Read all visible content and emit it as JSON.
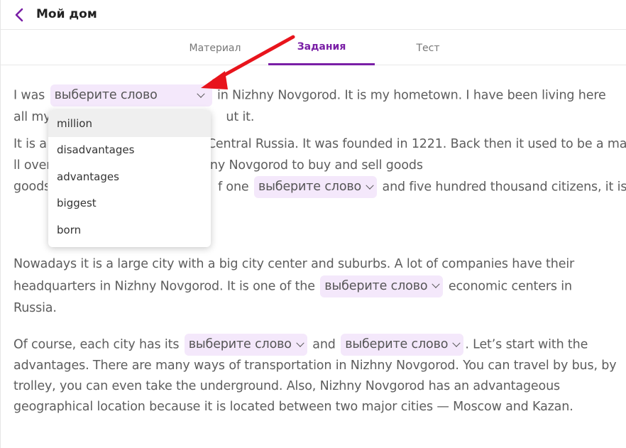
{
  "header": {
    "title": "Мой дом"
  },
  "tabs": [
    {
      "label": "Материал"
    },
    {
      "label": "Задания"
    },
    {
      "label": "Тест"
    }
  ],
  "select_placeholder": "выберите слово",
  "paragraphs": {
    "p1": {
      "t1": "I was",
      "t2": "in Nizhny Novgorod. It is my hometown. I have been living here all my life",
      "t3": "ut it."
    },
    "p2": {
      "t1": "It is a",
      "t2": "Central Russia. It was founded in 1221. Back then it used to be a major",
      "t3": "ll over the country came to Nizhny Novgorod to buy and sell goods",
      "t4": "f one",
      "t5": "and five hundred thousand citizens, it is the"
    },
    "p3": {
      "t1": "Nowadays it is a large city with a big city center and suburbs. A lot of companies have their headquarters in Nizhny Novgorod. It is one of the",
      "t2": "economic centers in Russia."
    },
    "p4": {
      "t1": "Of course, each city has its",
      "t2": "and",
      "t3": ". Let’s start with the advantages. There are many ways of transportation in Nizhny Novgorod. You can travel by bus, by trolley, you can even take the underground. Also, Nizhny Novgorod has an advantageous geographical location because it is located between two major cities — Moscow and Kazan."
    }
  },
  "dropdown": {
    "options": [
      "million",
      "disadvantages",
      "advantages",
      "biggest",
      "born"
    ],
    "highlighted": "million"
  },
  "colors": {
    "accent": "#7a1fa6",
    "select_bg": "#f4e8fb",
    "arrow": "#e8141c"
  }
}
